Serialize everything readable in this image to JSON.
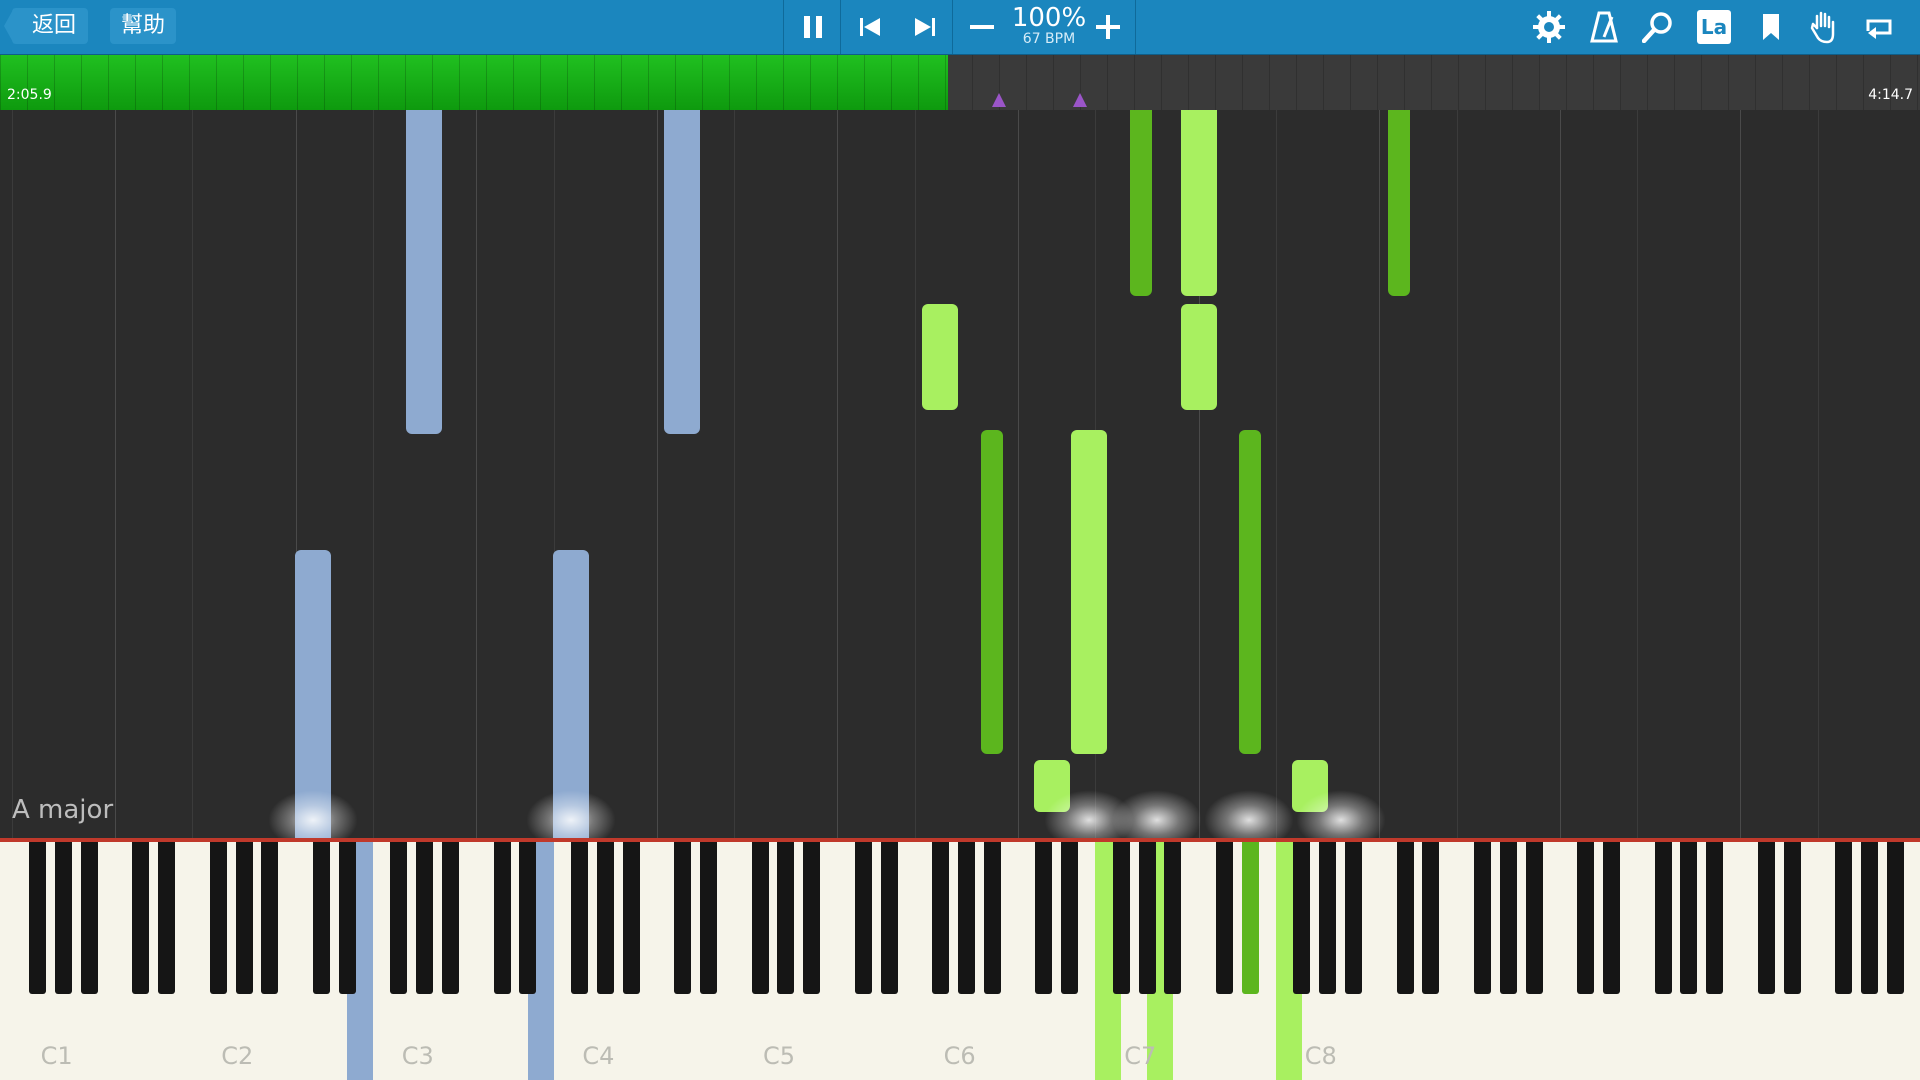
{
  "toolbar": {
    "back_label": "返回",
    "help_label": "幫助",
    "tempo_percent": "100%",
    "tempo_bpm": "67 BPM",
    "icons": [
      "pause-icon",
      "skip-back-icon",
      "skip-forward-icon",
      "minus-icon",
      "plus-icon",
      "gear-icon",
      "metronome-icon",
      "magnifier-icon",
      "label-icon",
      "bookmark-icon",
      "hand-icon",
      "loop-icon"
    ],
    "label_icon_text": "La"
  },
  "timeline": {
    "current_time": "2:05.9",
    "total_time": "4:14.7",
    "progress_fraction": 0.494,
    "fill_color": "#18b018"
  },
  "key_signature": "A major",
  "keyboard": {
    "octave_labels": [
      "C1",
      "C2",
      "C3",
      "C4",
      "C5",
      "C6",
      "C7",
      "C8"
    ]
  },
  "colors": {
    "toolbar": "#1b86be",
    "left_hand": "#8eaad0",
    "right_hand_light": "#a8f060",
    "right_hand_dark": "#5cb61e"
  }
}
